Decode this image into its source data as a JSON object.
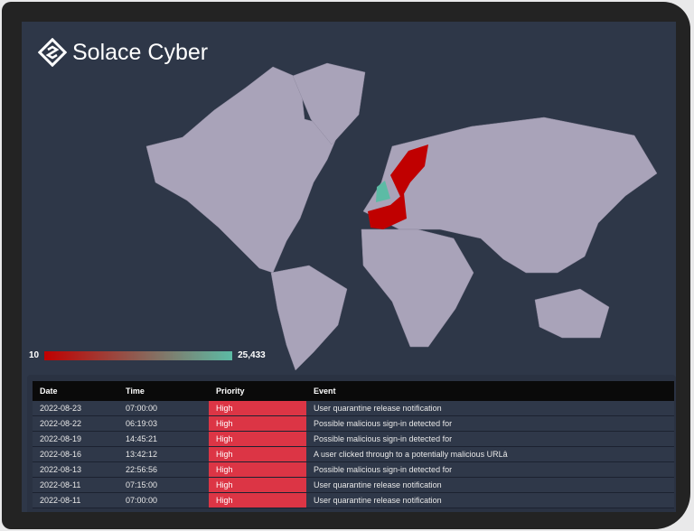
{
  "brand": {
    "name": "Solace Cyber"
  },
  "map": {
    "legend_min": "10",
    "legend_max": "25,433",
    "color_low": "#c00000",
    "color_high": "#5cbba5",
    "land_color": "#a9a3b9",
    "highlighted": [
      {
        "region": "Scandinavia",
        "level": "low"
      },
      {
        "region": "Western Europe",
        "level": "low"
      },
      {
        "region": "United Kingdom",
        "level": "high"
      }
    ]
  },
  "table": {
    "columns": [
      "Date",
      "Time",
      "Priority",
      "Event"
    ],
    "rows": [
      [
        "2022-08-23",
        "07:00:00",
        "High",
        "User quarantine release notification"
      ],
      [
        "2022-08-22",
        "06:19:03",
        "High",
        "Possible malicious sign-in detected for"
      ],
      [
        "2022-08-19",
        "14:45:21",
        "High",
        "Possible malicious sign-in detected for"
      ],
      [
        "2022-08-16",
        "13:42:12",
        "High",
        "A user clicked through to a potentially malicious URLâ"
      ],
      [
        "2022-08-13",
        "22:56:56",
        "High",
        "Possible malicious sign-in detected for"
      ],
      [
        "2022-08-11",
        "07:15:00",
        "High",
        "User quarantine release notification"
      ],
      [
        "2022-08-11",
        "07:00:00",
        "High",
        "User quarantine release notification"
      ]
    ]
  }
}
